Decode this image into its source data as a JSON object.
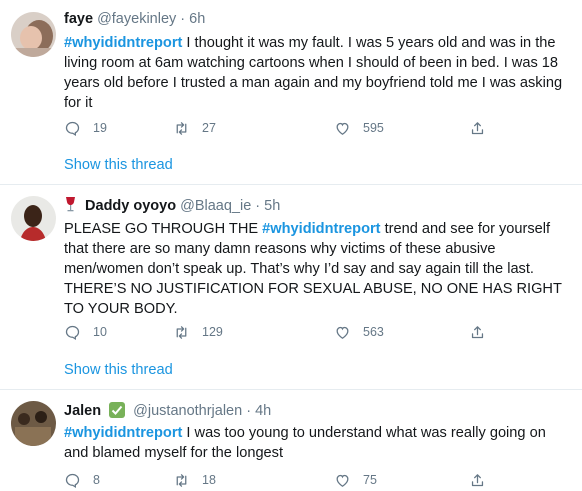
{
  "tweets": [
    {
      "name": "faye",
      "handle": "@fayekinley",
      "separator": "·",
      "time": "6h",
      "hashtag": "#whyididntreport",
      "text": " I thought it was my fault. I was 5 years old and was in the living room at 6am watching cartoons when I should of been in bed. I was 18 years old before I trusted a man again and my boyfriend told me I was asking for it",
      "replies": "19",
      "retweets": "27",
      "likes": "595",
      "show_thread": "Show this thread"
    },
    {
      "name": "Daddy oyoyo",
      "handle": "@Blaaq_ie",
      "separator": "·",
      "time": "5h",
      "text_before": "PLEASE GO THROUGH THE ",
      "hashtag": "#whyididntreport",
      "text": " trend and see for yourself that there are so many damn reasons why victims of these abusive men/women don’t speak up. That’s why I’d say and say again till the last. THERE’S NO JUSTIFICATION FOR SEXUAL ABUSE, NO ONE HAS RIGHT TO YOUR BODY.",
      "replies": "10",
      "retweets": "129",
      "likes": "563",
      "show_thread": "Show this thread"
    },
    {
      "name": "Jalen",
      "handle": "@justanothrjalen",
      "separator": "·",
      "time": "4h",
      "hashtag": "#whyididntreport",
      "text": " I was too young to understand what was really going on and blamed myself for the longest",
      "replies": "8",
      "retweets": "18",
      "likes": "75"
    }
  ],
  "colors": {
    "link": "#1b95e0",
    "muted": "#657786",
    "divider": "#e6ecf0"
  },
  "icons": [
    "reply-icon",
    "retweet-icon",
    "like-icon",
    "share-icon",
    "wine-glass-icon",
    "check-badge-icon"
  ]
}
